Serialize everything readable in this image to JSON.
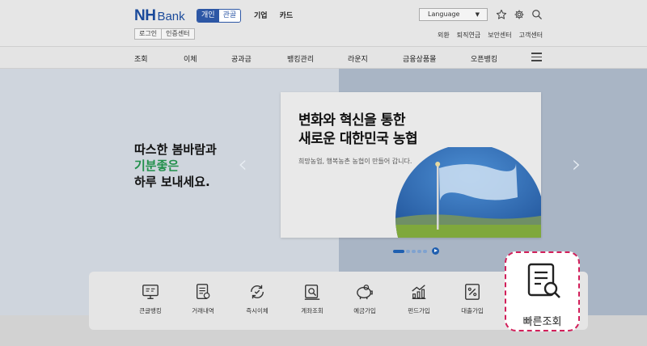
{
  "header": {
    "logo_nh": "NH",
    "logo_bank": "Bank",
    "segment": {
      "active": "개인",
      "inactive": "관골"
    },
    "top_menu": [
      "기업",
      "카드"
    ],
    "login": "로그인",
    "cert": "인증센터",
    "language": "Language",
    "util_links": [
      "외환",
      "퇴직연금",
      "보안센터",
      "고객센터"
    ],
    "icons": [
      "star-icon",
      "gear-icon",
      "search-icon"
    ]
  },
  "gnb": [
    "조회",
    "이체",
    "공과금",
    "뱅킹관리",
    "라운지",
    "금융상품몰",
    "오픈뱅킹"
  ],
  "hero": {
    "tagline_line1": "따스한 봄바람과",
    "tagline_line2": "기분좋은",
    "tagline_line3": "하루 보내세요."
  },
  "banner": {
    "headline_line1": "변화와 혁신을 통한",
    "headline_line2": "새로운 대한민국 농협",
    "subtext": "희망농업, 행복농촌 농협이 만들어 갑니다."
  },
  "quick_menu": [
    {
      "label": "큰글뱅킹",
      "icon": "large-text-banking-icon"
    },
    {
      "label": "거래내역",
      "icon": "transaction-history-icon"
    },
    {
      "label": "즉시이체",
      "icon": "instant-transfer-icon"
    },
    {
      "label": "계좌조회",
      "icon": "account-inquiry-icon"
    },
    {
      "label": "예금가입",
      "icon": "deposit-signup-icon"
    },
    {
      "label": "펀드가입",
      "icon": "fund-signup-icon"
    },
    {
      "label": "대출가입",
      "icon": "loan-signup-icon"
    }
  ],
  "quick_lookup": {
    "label": "빠른조회",
    "icon": "quick-lookup-icon"
  },
  "colors": {
    "brand_blue": "#1a4a9b",
    "accent_green": "#21904b",
    "highlight_pink": "#d21f5a"
  }
}
